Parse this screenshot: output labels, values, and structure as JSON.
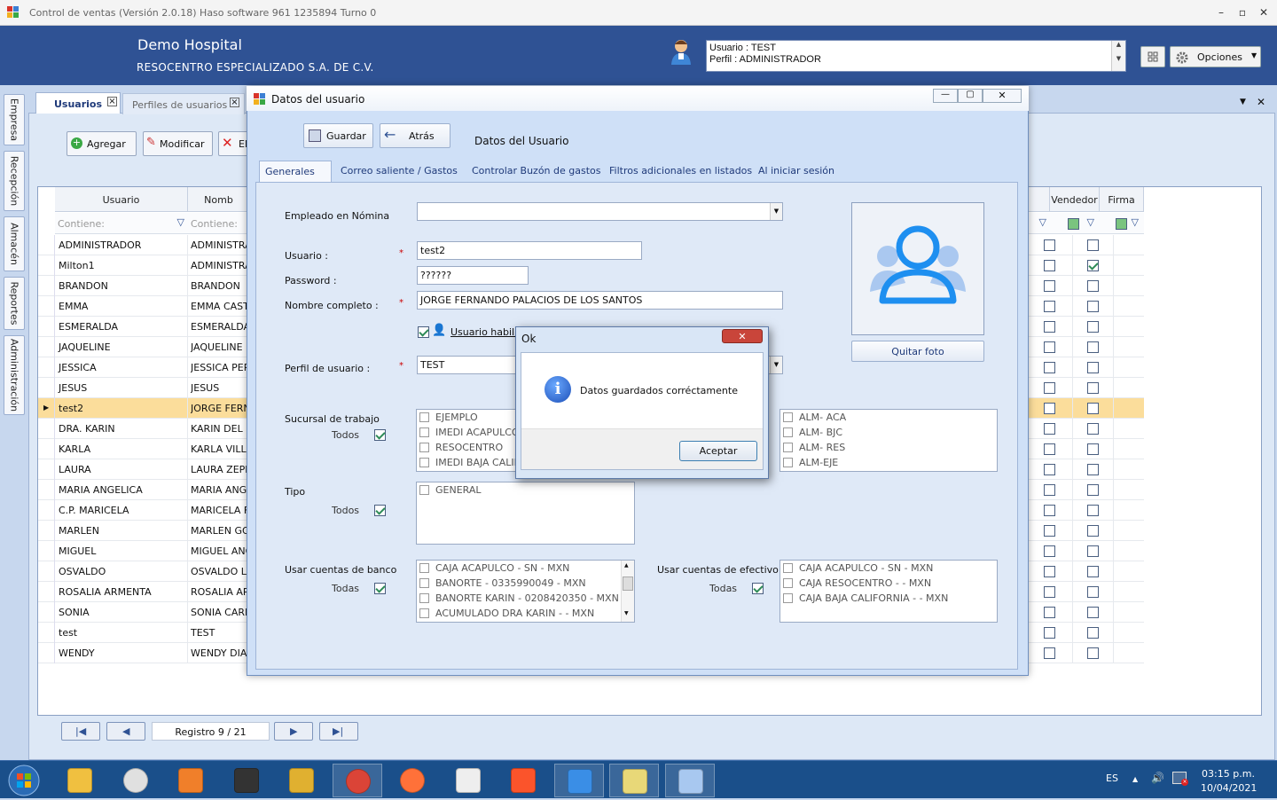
{
  "window": {
    "title": "Control de ventas  (Versión 2.0.18)  Haso software  961 1235894  Turno 0"
  },
  "header": {
    "company": "Demo Hospital",
    "subtitle": "RESOCENTRO ESPECIALIZADO S.A. DE C.V.",
    "user_line": "Usuario : TEST",
    "profile_line": "Perfil : ADMINISTRADOR",
    "options_label": "Opciones"
  },
  "sidebar": {
    "items": [
      "Empresa",
      "Recepción",
      "Almacén",
      "Reportes",
      "Administración"
    ]
  },
  "doc_tabs": [
    {
      "label": "Usuarios"
    },
    {
      "label": "Perfiles de usuarios"
    }
  ],
  "toolbar": {
    "add": "Agregar",
    "edit": "Modificar",
    "delete": "El"
  },
  "grid": {
    "headers": {
      "user": "Usuario",
      "name": "Nomb",
      "seller": "Vendedor",
      "signature": "Firma"
    },
    "filter_placeholder": "Contiene:",
    "rows": [
      {
        "user": "ADMINISTRADOR",
        "name": "ADMINISTRA",
        "seller": false,
        "firma": false
      },
      {
        "user": "Milton1",
        "name": "ADMINISTRA",
        "seller": false,
        "firma": true
      },
      {
        "user": "BRANDON",
        "name": "BRANDON",
        "seller": false,
        "firma": false
      },
      {
        "user": "EMMA",
        "name": "EMMA CAST",
        "seller": false,
        "firma": false
      },
      {
        "user": "ESMERALDA",
        "name": "ESMERALDA",
        "seller": false,
        "firma": false
      },
      {
        "user": "JAQUELINE",
        "name": "JAQUELINE E",
        "seller": false,
        "firma": false
      },
      {
        "user": "JESSICA",
        "name": "JESSICA PER",
        "seller": false,
        "firma": false
      },
      {
        "user": "JESUS",
        "name": "JESUS",
        "seller": false,
        "firma": false
      },
      {
        "user": "test2",
        "name": "JORGE FERN",
        "seller": false,
        "firma": false
      },
      {
        "user": "DRA. KARIN",
        "name": "KARIN DEL F",
        "seller": false,
        "firma": false
      },
      {
        "user": "KARLA",
        "name": "KARLA VILLA",
        "seller": false,
        "firma": false
      },
      {
        "user": "LAURA",
        "name": "LAURA ZEPE",
        "seller": false,
        "firma": false
      },
      {
        "user": "MARIA ANGELICA",
        "name": "MARIA ANGI",
        "seller": false,
        "firma": false
      },
      {
        "user": "C.P. MARICELA",
        "name": "MARICELA FI",
        "seller": false,
        "firma": false
      },
      {
        "user": "MARLEN",
        "name": "MARLEN GO",
        "seller": false,
        "firma": false
      },
      {
        "user": "MIGUEL",
        "name": "MIGUEL ANG",
        "seller": false,
        "firma": false
      },
      {
        "user": "OSVALDO",
        "name": "OSVALDO LC",
        "seller": false,
        "firma": false
      },
      {
        "user": "ROSALIA ARMENTA",
        "name": "ROSALIA ARI",
        "seller": false,
        "firma": false
      },
      {
        "user": "SONIA",
        "name": "SONIA CARR",
        "seller": false,
        "firma": false
      },
      {
        "user": "test",
        "name": "TEST",
        "seller": false,
        "firma": false
      },
      {
        "user": "WENDY",
        "name": "WENDY DIAZ",
        "seller": false,
        "firma": false
      }
    ],
    "selected_index": 8
  },
  "navigator": {
    "record": "Registro  9 / 21"
  },
  "dialog": {
    "title": "Datos del usuario",
    "save": "Guardar",
    "back": "Atrás",
    "heading": "Datos del Usuario",
    "tabs": [
      "Generales",
      "Correo saliente / Gastos",
      "Controlar Buzón de gastos",
      "Filtros adicionales en listados",
      "Al iniciar sesión"
    ],
    "form": {
      "employee_label": "Empleado en Nómina",
      "user_label": "Usuario :",
      "user_value": "test2",
      "password_label": "Password :",
      "password_value": "??????",
      "fullname_label": "Nombre completo :",
      "fullname_value": "JORGE FERNANDO PALACIOS DE LOS SANTOS",
      "enabled_label": "Usuario habilit",
      "profile_label": "Perfil de usuario :",
      "profile_value": "TEST",
      "branch_label": "Sucursal de trabajo",
      "all_label": "Todos",
      "type_label": "Tipo",
      "bank_label": "Usar cuentas de banco",
      "all_label2": "Todas",
      "cash_label": "Usar cuentas de efectivo",
      "remove_photo": "Quitar foto",
      "branches": [
        "EJEMPLO",
        "IMEDI ACAPULCO",
        "RESOCENTRO",
        "IMEDI BAJA CALIF"
      ],
      "warehouses": [
        "ALM- ACA",
        "ALM- BJC",
        "ALM- RES",
        "ALM-EJE"
      ],
      "types": [
        "GENERAL"
      ],
      "banks": [
        "CAJA ACAPULCO - SN - MXN",
        "BANORTE - 0335990049 - MXN",
        "BANORTE KARIN - 0208420350 - MXN",
        "ACUMULADO DRA KARIN -  - MXN"
      ],
      "cash": [
        "CAJA ACAPULCO - SN - MXN",
        "CAJA RESOCENTRO -  - MXN",
        "CAJA BAJA CALIFORNIA -  - MXN"
      ]
    }
  },
  "message": {
    "title": "Ok",
    "text": "Datos guardados corréctamente",
    "accept": "Aceptar"
  },
  "taskbar": {
    "lang": "ES",
    "time": "03:15 p.m.",
    "date": "10/04/2021"
  },
  "colors": {
    "header": "#2f5294",
    "selection": "#fbdd9b",
    "taskbar": "#1a4f8a"
  }
}
